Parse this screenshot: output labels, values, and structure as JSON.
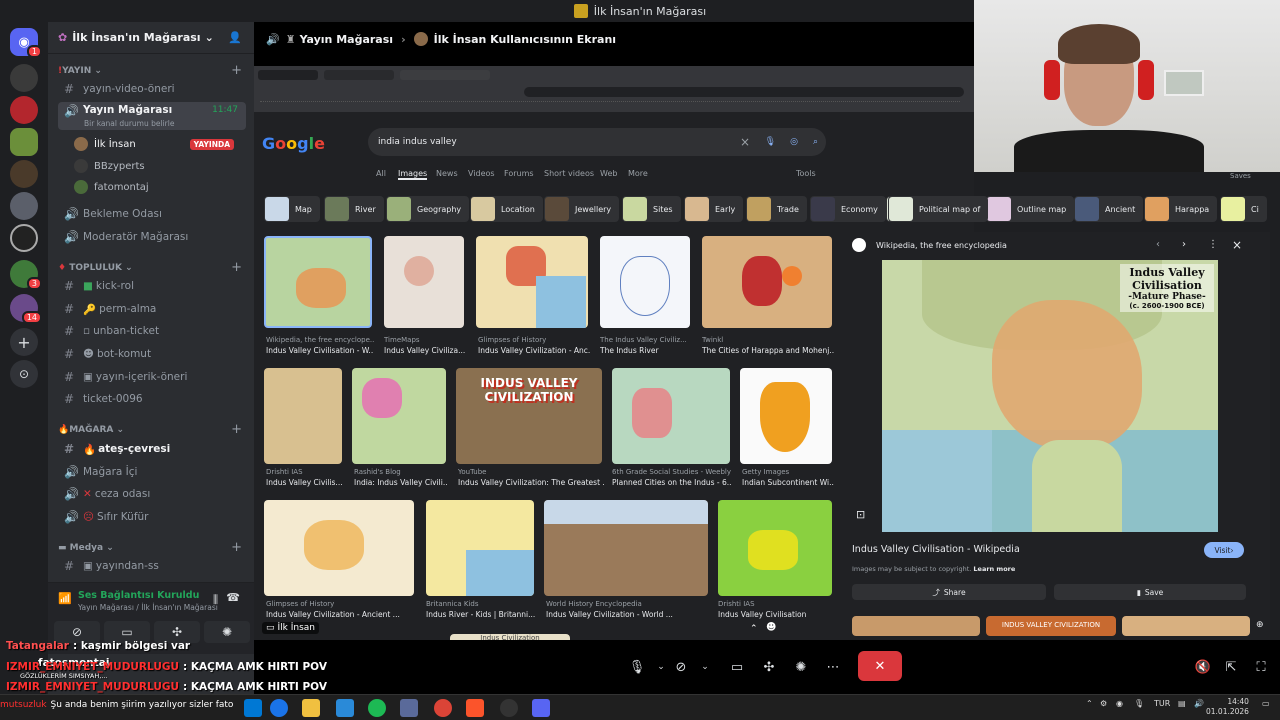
{
  "window": {
    "title": "İlk İnsan'ın Mağarası"
  },
  "server": {
    "name": "İlk İnsan'ın Mağarası"
  },
  "categories": {
    "yayin": "YAYIN",
    "topluluk": "TOPLULUK",
    "magara": "MAĞARA",
    "medya": "Medya"
  },
  "channels_yayin": [
    {
      "label": "yayın-video-öneri"
    }
  ],
  "active_voice": {
    "name": "Yayın Mağarası",
    "time": "11:47",
    "status": "Bir kanal durumu belirle"
  },
  "voice_users": [
    {
      "name": "İlk İnsan",
      "badge": "YAYINDA"
    },
    {
      "name": "BBzyperts"
    },
    {
      "name": "fatomontaj"
    }
  ],
  "channels_after": [
    "Bekleme Odası",
    "Moderatör Mağarası"
  ],
  "channels_topluluk": [
    "kick-rol",
    "perm-alma",
    "unban-ticket",
    "bot-komut",
    "yayın-içerik-öneri",
    "ticket-0096"
  ],
  "channels_magara": [
    "ateş-çevresi",
    "Mağara İçi",
    "ceza odası",
    "Sıfır Küfür"
  ],
  "channels_medya": [
    "yayından-ss"
  ],
  "voice_panel": {
    "status": "Ses Bağlantısı Kuruldu",
    "location": "Yayın Mağarası / İlk İnsan'ın Mağarası"
  },
  "stream": {
    "channel": "Yayın Mağarası",
    "title": "İlk İnsan Kullanıcısının Ekranı",
    "streamer_label": "İlk İnsan"
  },
  "browser": {
    "query": "india indus valley",
    "tabs": [
      "All",
      "Images",
      "News",
      "Videos",
      "Forums",
      "Short videos",
      "Web",
      "More"
    ],
    "tools": "Tools",
    "saves": "Saves",
    "chips": [
      "Map",
      "River",
      "Geography",
      "Location",
      "Jewellery",
      "Sites",
      "Early",
      "Trade",
      "Economy",
      "Political map of",
      "Outline map",
      "Ancient",
      "Harappa",
      "Ci"
    ],
    "results": [
      {
        "source": "Wikipedia, the free encyclope...",
        "title": "Indus Valley Civilisation - W..."
      },
      {
        "source": "TimeMaps",
        "title": "Indus Valley Civiliza..."
      },
      {
        "source": "Glimpses of History",
        "title": "Indus Valley Civilization - Anc..."
      },
      {
        "source": "The Indus Valley Civiliz...",
        "title": "The Indus River"
      },
      {
        "source": "Twinkl",
        "title": "The Cities of Harappa and Mohenj..."
      },
      {
        "source": "Drishti IAS",
        "title": "Indus Valley Civilis..."
      },
      {
        "source": "Rashid's Blog",
        "title": "India: Indus Valley Civili..."
      },
      {
        "source": "YouTube",
        "title": "Indus Valley Civilization: The Greatest ..."
      },
      {
        "source": "6th Grade Social Studies - Weebly",
        "title": "Planned Cities on the Indus - 6..."
      },
      {
        "source": "Getty Images",
        "title": "Indian Subcontinent Wi..."
      },
      {
        "source": "Glimpses of History",
        "title": "Indus Valley Civilization - Ancient ..."
      },
      {
        "source": "Britannica Kids",
        "title": "Indus River - Kids | Britanni..."
      },
      {
        "source": "World History Encyclopedia",
        "title": "Indus Valley Civilization - World ..."
      },
      {
        "source": "Drishti IAS",
        "title": "Indus Valley Civilisation"
      }
    ],
    "thumb_text": {
      "ivc": "INDUS VALLEY CIVILIZATION",
      "ivc_bottom": "Indus Civilization"
    },
    "panel": {
      "source": "Wikipedia, the free encyclopedia",
      "map_title": "Indus Valley Civilisation",
      "map_subtitle": "-Mature Phase-",
      "map_dates": "(c. 2600-1900 BCE)",
      "title": "Indus Valley Civilisation - Wikipedia",
      "visit": "Visit",
      "copyright": "Images may be subject to copyright.",
      "learn_more": "Learn more",
      "share": "Share",
      "save": "Save",
      "bottom_thumb": "INDUS VALLEY CIVILIZATION"
    }
  },
  "chat": [
    {
      "user": "Tatangalar",
      "msg": "kaşmir bölgesi var"
    },
    {
      "user": "fatosmontaj",
      "msg": ""
    },
    {
      "user": "IZMIR_EMNIYET_MUDURLUGU",
      "msg": "KAÇMA AMK HIRTI POV"
    },
    {
      "user": "IZMIR_EMNIYET_MUDURLUGU",
      "msg": "KAÇMA AMK HIRTI POV"
    },
    {
      "user": "mutsuzluk",
      "msg": "Şu anda benim şiirim yazılıyor sizler fato"
    }
  ],
  "chat_sub": "GÖZLÜKLERİM SIMSIYAH,...",
  "taskbar": {
    "lang": "TUR",
    "time": "14:40",
    "date": "01.01.2026"
  },
  "colors": {
    "discord_bg": "#2b2d31",
    "live_red": "#da373c",
    "google_bg": "#202124",
    "accent": "#8ab4f8"
  }
}
